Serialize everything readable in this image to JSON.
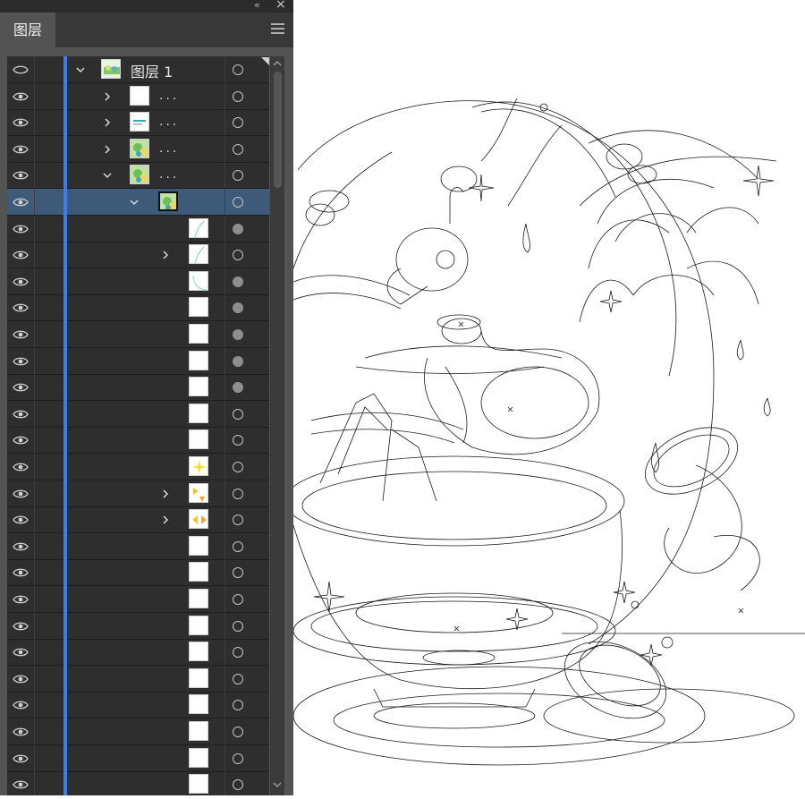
{
  "panel": {
    "tab_label": "图层",
    "collapse_glyph": "«",
    "close_glyph": "×",
    "menu_icon": "hamburger-menu-icon"
  },
  "colors": {
    "panel_bg": "#535353",
    "list_bg": "#2e2e2e",
    "selected_row": "#3d5a78",
    "layer_color_bar": "#3c7cf0"
  },
  "layers": {
    "top_label": "图层 1",
    "rows": [
      {
        "depth": 0,
        "expand": "open",
        "label": "图层 1",
        "thumb": "scene",
        "target": "empty"
      },
      {
        "depth": 1,
        "expand": "closed",
        "label": "...",
        "thumb": "blank",
        "target": "empty"
      },
      {
        "depth": 1,
        "expand": "closed",
        "label": "...",
        "thumb": "text",
        "target": "empty"
      },
      {
        "depth": 1,
        "expand": "closed",
        "label": "...",
        "thumb": "color",
        "target": "empty"
      },
      {
        "depth": 1,
        "expand": "open",
        "label": "...",
        "thumb": "color",
        "target": "empty"
      },
      {
        "depth": 2,
        "expand": "open",
        "label": "",
        "thumb": "color",
        "target": "empty",
        "selected": true
      },
      {
        "depth": 3,
        "expand": "none",
        "label": "",
        "thumb": "line",
        "target": "filled"
      },
      {
        "depth": 3,
        "expand": "closed",
        "label": "",
        "thumb": "line",
        "target": "empty"
      },
      {
        "depth": 3,
        "expand": "none",
        "label": "",
        "thumb": "curve",
        "target": "filled"
      },
      {
        "depth": 3,
        "expand": "none",
        "label": "",
        "thumb": "blank",
        "target": "filled"
      },
      {
        "depth": 3,
        "expand": "none",
        "label": "",
        "thumb": "blank",
        "target": "filled"
      },
      {
        "depth": 3,
        "expand": "none",
        "label": "",
        "thumb": "blank",
        "target": "filled"
      },
      {
        "depth": 3,
        "expand": "none",
        "label": "",
        "thumb": "blank",
        "target": "filled"
      },
      {
        "depth": 3,
        "expand": "none",
        "label": "",
        "thumb": "blank",
        "target": "empty"
      },
      {
        "depth": 3,
        "expand": "none",
        "label": "",
        "thumb": "blank",
        "target": "empty"
      },
      {
        "depth": 3,
        "expand": "none",
        "label": "",
        "thumb": "star",
        "target": "empty"
      },
      {
        "depth": 3,
        "expand": "closed",
        "label": "",
        "thumb": "tri",
        "target": "empty"
      },
      {
        "depth": 3,
        "expand": "closed",
        "label": "",
        "thumb": "tri2",
        "target": "empty"
      },
      {
        "depth": 3,
        "expand": "none",
        "label": "",
        "thumb": "blank",
        "target": "empty"
      },
      {
        "depth": 3,
        "expand": "none",
        "label": "",
        "thumb": "blank",
        "target": "empty"
      },
      {
        "depth": 3,
        "expand": "none",
        "label": "",
        "thumb": "blank",
        "target": "empty"
      },
      {
        "depth": 3,
        "expand": "none",
        "label": "",
        "thumb": "blank",
        "target": "empty"
      },
      {
        "depth": 3,
        "expand": "none",
        "label": "",
        "thumb": "blank",
        "target": "empty"
      },
      {
        "depth": 3,
        "expand": "none",
        "label": "",
        "thumb": "blank",
        "target": "empty"
      },
      {
        "depth": 3,
        "expand": "none",
        "label": "",
        "thumb": "blank",
        "target": "empty"
      },
      {
        "depth": 3,
        "expand": "none",
        "label": "",
        "thumb": "blank",
        "target": "empty"
      },
      {
        "depth": 3,
        "expand": "none",
        "label": "",
        "thumb": "blank",
        "target": "empty"
      },
      {
        "depth": 3,
        "expand": "none",
        "label": "",
        "thumb": "blank",
        "target": "empty"
      },
      {
        "depth": 3,
        "expand": "none",
        "label": "",
        "thumb": "blank",
        "target": "empty"
      }
    ]
  },
  "canvas": {
    "content": "outline-illustration"
  }
}
